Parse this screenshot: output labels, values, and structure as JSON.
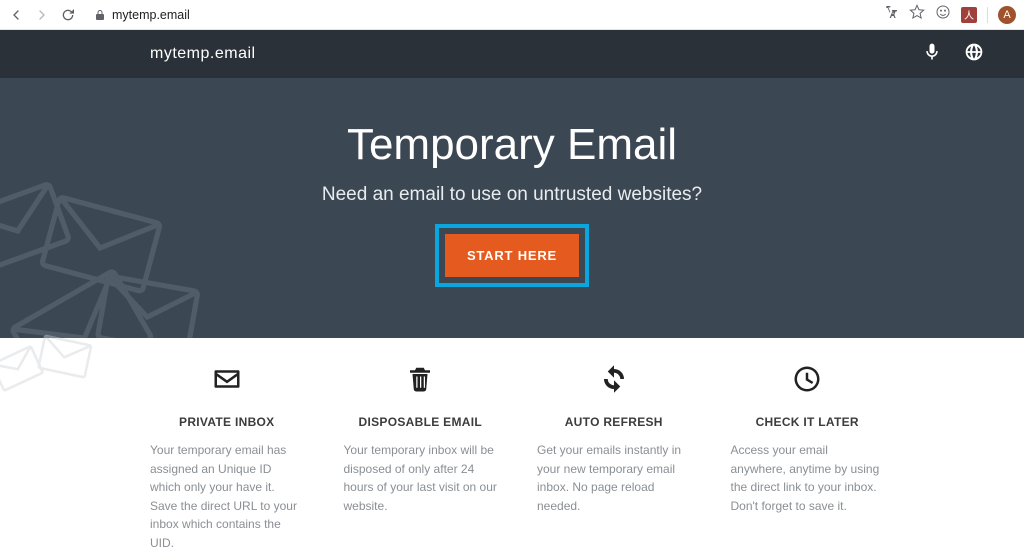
{
  "browser": {
    "url": "mytemp.email",
    "avatar_letter": "A",
    "ext_badge": "人"
  },
  "header": {
    "brand": "mytemp.email"
  },
  "hero": {
    "title": "Temporary Email",
    "subtitle": "Need an email to use on untrusted websites?",
    "cta_label": "START HERE"
  },
  "features": [
    {
      "icon": "envelope-icon",
      "title": "PRIVATE INBOX",
      "desc": "Your temporary email has assigned an Unique ID which only your have it. Save the direct URL to your inbox which contains the UID."
    },
    {
      "icon": "trash-icon",
      "title": "DISPOSABLE EMAIL",
      "desc": "Your temporary inbox will be disposed of only after 24 hours of your last visit on our website."
    },
    {
      "icon": "refresh-icon",
      "title": "AUTO REFRESH",
      "desc": "Get your emails instantly in your new temporary email inbox. No page reload needed."
    },
    {
      "icon": "clock-icon",
      "title": "CHECK IT LATER",
      "desc": "Access your email anywhere, anytime by using the direct link to your inbox. Don't forget to save it."
    }
  ]
}
